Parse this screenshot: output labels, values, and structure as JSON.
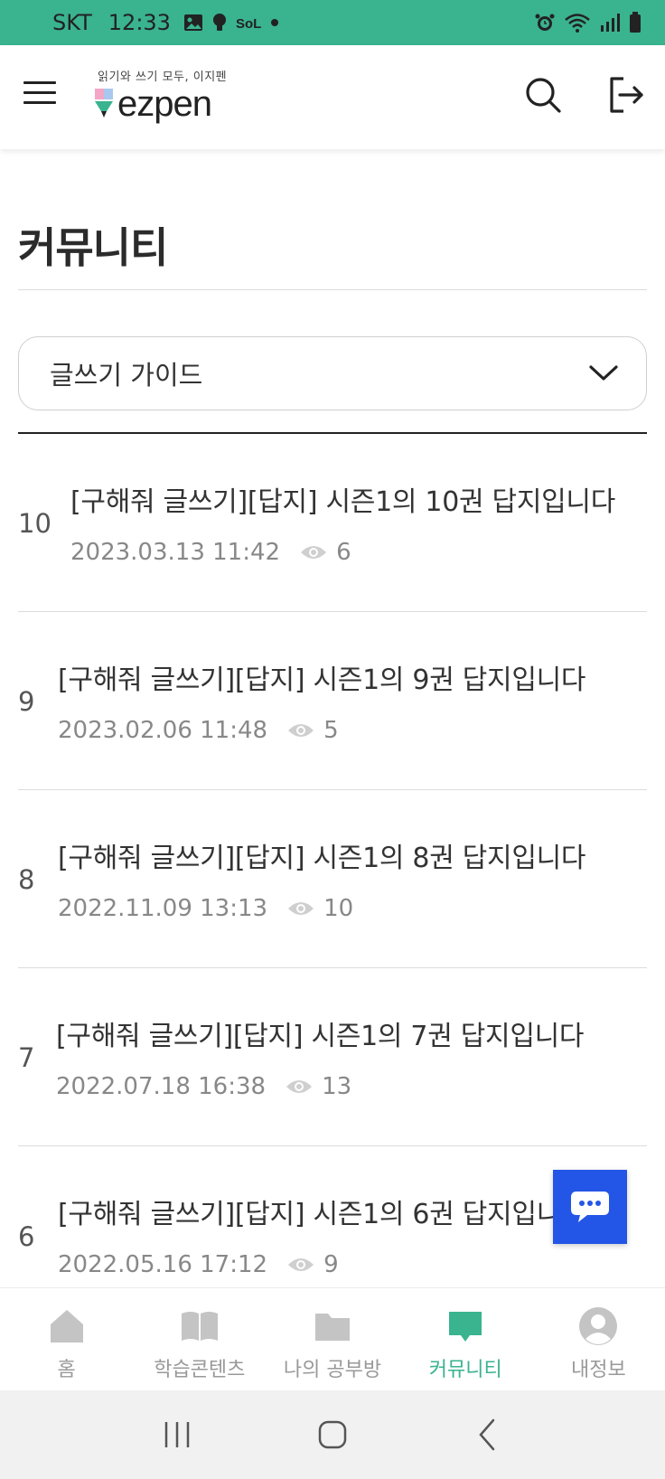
{
  "status_bar": {
    "carrier": "SKT",
    "time": "12:33"
  },
  "header": {
    "tagline": "읽기와 쓰기 모두, 이지펜",
    "logo_text": "ezpen",
    "icons": {
      "menu": "hamburger-menu-icon",
      "search": "search-icon",
      "logout": "logout-icon"
    }
  },
  "page": {
    "title": "커뮤니티"
  },
  "category": {
    "selected": "글쓰기 가이드",
    "icon": "chevron-down-icon"
  },
  "posts": [
    {
      "no": "10",
      "title": "[구해줘 글쓰기][답지] 시즌1의 10권 답지입니다",
      "date": "2023.03.13 11:42",
      "views": "6"
    },
    {
      "no": "9",
      "title": "[구해줘 글쓰기][답지] 시즌1의 9권 답지입니다",
      "date": "2023.02.06 11:48",
      "views": "5"
    },
    {
      "no": "8",
      "title": "[구해줘 글쓰기][답지] 시즌1의 8권 답지입니다",
      "date": "2022.11.09 13:13",
      "views": "10"
    },
    {
      "no": "7",
      "title": "[구해줘 글쓰기][답지] 시즌1의 7권 답지입니다",
      "date": "2022.07.18 16:38",
      "views": "13"
    },
    {
      "no": "6",
      "title": "[구해줘 글쓰기][답지] 시즌1의 6권 답지입니",
      "date": "2022.05.16 17:12",
      "views": "9"
    }
  ],
  "bottom_nav": [
    {
      "label": "홈",
      "icon": "home-icon"
    },
    {
      "label": "학습콘텐츠",
      "icon": "book-icon"
    },
    {
      "label": "나의 공부방",
      "icon": "folder-icon"
    },
    {
      "label": "커뮤니티",
      "icon": "chat-bubble-icon",
      "active": true
    },
    {
      "label": "내정보",
      "icon": "user-icon"
    }
  ],
  "colors": {
    "accent": "#3ab38f",
    "fab": "#2356e6",
    "inactive": "#bdbdbd"
  }
}
